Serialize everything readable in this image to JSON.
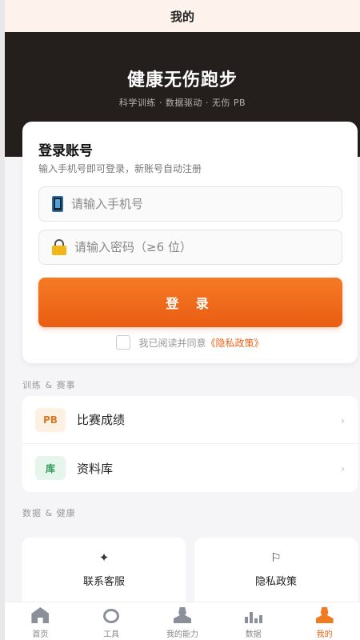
{
  "topbar": {
    "title": "我的"
  },
  "hero": {
    "title": "健康无伤跑步",
    "subtitle": "科学训练 · 数据驱动 · 无伤 PB"
  },
  "login": {
    "title": "登录账号",
    "subtitle": "输入手机号即可登录，新账号自动注册",
    "phone_placeholder": "请输入手机号",
    "password_placeholder": "请输入密码（≥6 位）",
    "button_label": "登 录",
    "agree_text": "我已阅读并同意",
    "privacy_link": "《隐私政策》"
  },
  "training_section": {
    "label": "训练 & 赛事",
    "items": [
      {
        "badge": "PB",
        "label": "比赛成绩"
      },
      {
        "badge": "库",
        "label": "资料库"
      }
    ]
  },
  "health_section": {
    "label": "数据 & 健康",
    "tiles": [
      {
        "icon": "✦",
        "label": "联系客服"
      },
      {
        "icon": "⚐",
        "label": "隐私政策"
      }
    ]
  },
  "tabbar": {
    "items": [
      {
        "label": "首页",
        "icon": "home-icon"
      },
      {
        "label": "工具",
        "icon": "tool-icon"
      },
      {
        "label": "我的能力",
        "icon": "user-icon"
      },
      {
        "label": "数据",
        "icon": "data-icon"
      },
      {
        "label": "我的",
        "icon": "me-icon"
      }
    ],
    "active_index": 4
  },
  "colors": {
    "accent": "#e8631a",
    "hero_bg": "#241f1c",
    "topbar_bg": "#fdf3ec"
  }
}
